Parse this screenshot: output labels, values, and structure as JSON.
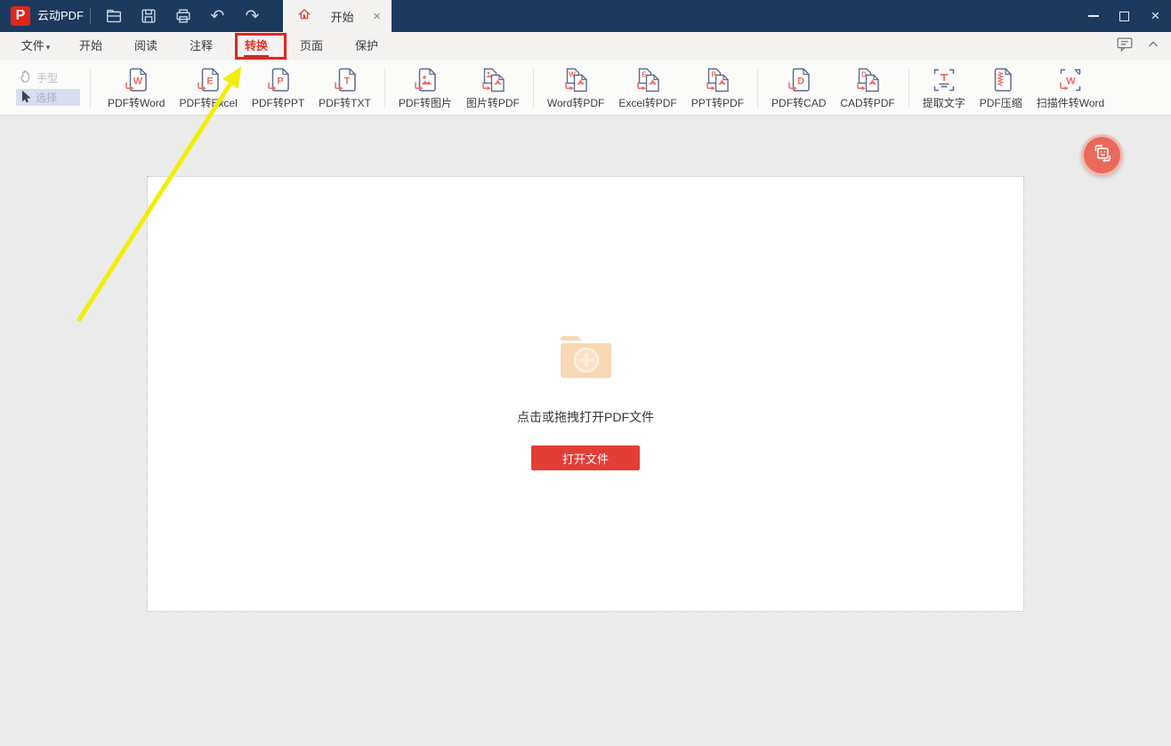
{
  "app": {
    "title": "云动PDF",
    "logo_letter": "P"
  },
  "titlebar": {
    "quick_actions": [
      {
        "name": "open-file",
        "icon": "folder-open-icon"
      },
      {
        "name": "save",
        "icon": "save-icon"
      },
      {
        "name": "print",
        "icon": "print-icon"
      },
      {
        "name": "undo",
        "icon": "undo-icon",
        "glyph": "↶"
      },
      {
        "name": "redo",
        "icon": "redo-icon",
        "glyph": "↷"
      }
    ],
    "tab": {
      "label": "开始",
      "icon": "home-icon",
      "close_glyph": "×"
    },
    "window_controls": {
      "minimize": "minimize-icon",
      "maximize": "maximize-icon",
      "close_glyph": "×"
    }
  },
  "menubar": {
    "items": [
      {
        "label": "文件",
        "name": "file",
        "caret": "▾"
      },
      {
        "label": "开始",
        "name": "home"
      },
      {
        "label": "阅读",
        "name": "read"
      },
      {
        "label": "注释",
        "name": "annotate"
      },
      {
        "label": "转换",
        "name": "convert",
        "active": true
      },
      {
        "label": "页面",
        "name": "page"
      },
      {
        "label": "保护",
        "name": "protect"
      }
    ],
    "right_icons": [
      "comment-icon",
      "collapse-ribbon-icon"
    ]
  },
  "toolbar": {
    "tools": [
      {
        "label": "手型",
        "name": "hand-tool",
        "icon": "hand-icon",
        "selected": false
      },
      {
        "label": "选择",
        "name": "select-tool",
        "icon": "cursor-icon",
        "selected": true
      }
    ],
    "groups": [
      [
        {
          "label": "PDF转Word",
          "name": "pdf-to-word",
          "icon": "doc-letter",
          "letter": "W"
        },
        {
          "label": "PDF转Excel",
          "name": "pdf-to-excel",
          "icon": "doc-letter",
          "letter": "E"
        },
        {
          "label": "PDF转PPT",
          "name": "pdf-to-ppt",
          "icon": "doc-letter",
          "letter": "P"
        },
        {
          "label": "PDF转TXT",
          "name": "pdf-to-txt",
          "icon": "doc-letter",
          "letter": "T"
        }
      ],
      [
        {
          "label": "PDF转图片",
          "name": "pdf-to-image",
          "icon": "doc-image"
        },
        {
          "label": "图片转PDF",
          "name": "image-to-pdf",
          "icon": "doc-pair",
          "back": "image"
        }
      ],
      [
        {
          "label": "Word转PDF",
          "name": "word-to-pdf",
          "icon": "doc-pair",
          "letter": "W"
        },
        {
          "label": "Excel转PDF",
          "name": "excel-to-pdf",
          "icon": "doc-pair",
          "letter": "E"
        },
        {
          "label": "PPT转PDF",
          "name": "ppt-to-pdf",
          "icon": "doc-pair",
          "letter": "P"
        }
      ],
      [
        {
          "label": "PDF转CAD",
          "name": "pdf-to-cad",
          "icon": "doc-letter",
          "letter": "D"
        },
        {
          "label": "CAD转PDF",
          "name": "cad-to-pdf",
          "icon": "doc-pair",
          "letter": "D"
        }
      ],
      [
        {
          "label": "提取文字",
          "name": "extract-text",
          "icon": "frame-text",
          "letter": "T"
        },
        {
          "label": "PDF压缩",
          "name": "pdf-compress",
          "icon": "doc-compress"
        },
        {
          "label": "扫描件转Word",
          "name": "scan-to-word",
          "icon": "frame-letter",
          "letter": "W"
        }
      ]
    ]
  },
  "dropzone": {
    "hint": "点击或拖拽打开PDF文件",
    "open_button": "打开文件",
    "folder_icon": "folder-plus-icon"
  },
  "fab": {
    "icon": "convert-assistant-icon"
  },
  "annotation": {
    "target": "转换",
    "elements": [
      "red-highlight-box",
      "yellow-arrow"
    ]
  },
  "colors": {
    "titlebar": "#1c3a5e",
    "accent_red": "#e23e35",
    "icon_red": "#ee6b5e",
    "icon_navy": "#5d6b8c",
    "folder_peach": "#f8d8b4",
    "highlight_red": "#e8231d",
    "arrow_yellow": "#f2ee06",
    "fab_red": "#e96a5b"
  }
}
